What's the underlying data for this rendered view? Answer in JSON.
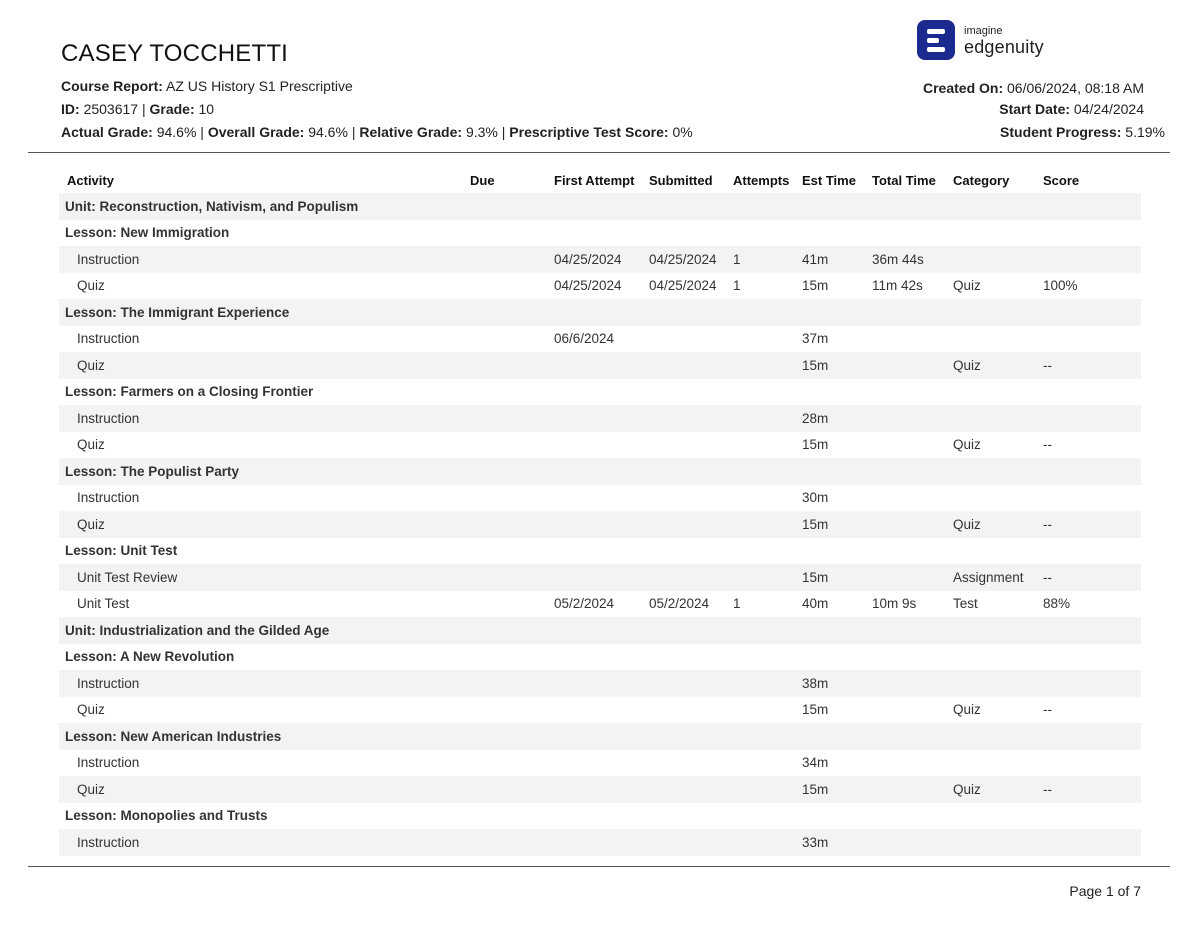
{
  "student": {
    "name": "CASEY TOCCHETTI"
  },
  "course": {
    "course_report_label": "Course Report:",
    "course_report_value": "AZ US History S1 Prescriptive",
    "id_label": "ID:",
    "id_value": "2503617",
    "sep": "|",
    "grade_label": "Grade:",
    "grade_value": "10",
    "actual_grade_label": "Actual Grade:",
    "actual_grade_value": "94.6%",
    "overall_grade_label": "Overall Grade:",
    "overall_grade_value": "94.6%",
    "relative_grade_label": "Relative Grade:",
    "relative_grade_value": "9.3%",
    "prescriptive_label": "Prescriptive Test Score:",
    "prescriptive_value": "0%",
    "created_label": "Created On:",
    "created_value": "06/06/2024, 08:18 AM",
    "start_label": "Start Date:",
    "start_value": "04/24/2024",
    "progress_label": "Student Progress:",
    "progress_value": "5.19%"
  },
  "logo": {
    "small": "imagine",
    "big": "edgenuity",
    "icon": "edgenuity-logo-icon",
    "color": "#1b2a8f"
  },
  "table": {
    "columns": [
      "Activity",
      "Due",
      "First Attempt",
      "Submitted",
      "Attempts",
      "Est Time",
      "Total Time",
      "Category",
      "Score"
    ],
    "rows": [
      {
        "type": "heading",
        "label": "Unit: Reconstruction, Nativism, and Populism"
      },
      {
        "type": "heading",
        "label": "Lesson: New Immigration"
      },
      {
        "type": "item",
        "cells": [
          "Instruction",
          "",
          "04/25/2024",
          "04/25/2024",
          "1",
          "41m",
          "36m 44s",
          "",
          ""
        ]
      },
      {
        "type": "item",
        "cells": [
          "Quiz",
          "",
          "04/25/2024",
          "04/25/2024",
          "1",
          "15m",
          "11m 42s",
          "Quiz",
          "100%"
        ]
      },
      {
        "type": "heading",
        "label": "Lesson: The Immigrant Experience"
      },
      {
        "type": "item",
        "cells": [
          "Instruction",
          "",
          "06/6/2024",
          "",
          "",
          "37m",
          "",
          "",
          ""
        ]
      },
      {
        "type": "item",
        "cells": [
          "Quiz",
          "",
          "",
          "",
          "",
          "15m",
          "",
          "Quiz",
          "--"
        ]
      },
      {
        "type": "heading",
        "label": "Lesson: Farmers on a Closing Frontier"
      },
      {
        "type": "item",
        "cells": [
          "Instruction",
          "",
          "",
          "",
          "",
          "28m",
          "",
          "",
          ""
        ]
      },
      {
        "type": "item",
        "cells": [
          "Quiz",
          "",
          "",
          "",
          "",
          "15m",
          "",
          "Quiz",
          "--"
        ]
      },
      {
        "type": "heading",
        "label": "Lesson: The Populist Party"
      },
      {
        "type": "item",
        "cells": [
          "Instruction",
          "",
          "",
          "",
          "",
          "30m",
          "",
          "",
          ""
        ]
      },
      {
        "type": "item",
        "cells": [
          "Quiz",
          "",
          "",
          "",
          "",
          "15m",
          "",
          "Quiz",
          "--"
        ]
      },
      {
        "type": "heading",
        "label": "Lesson: Unit Test"
      },
      {
        "type": "item",
        "cells": [
          "Unit Test Review",
          "",
          "",
          "",
          "",
          "15m",
          "",
          "Assignment",
          "--"
        ]
      },
      {
        "type": "item",
        "cells": [
          "Unit Test",
          "",
          "05/2/2024",
          "05/2/2024",
          "1",
          "40m",
          "10m 9s",
          "Test",
          "88%"
        ]
      },
      {
        "type": "heading",
        "label": "Unit: Industrialization and the Gilded Age"
      },
      {
        "type": "heading",
        "label": "Lesson: A New Revolution"
      },
      {
        "type": "item",
        "cells": [
          "Instruction",
          "",
          "",
          "",
          "",
          "38m",
          "",
          "",
          ""
        ]
      },
      {
        "type": "item",
        "cells": [
          "Quiz",
          "",
          "",
          "",
          "",
          "15m",
          "",
          "Quiz",
          "--"
        ]
      },
      {
        "type": "heading",
        "label": "Lesson: New American Industries"
      },
      {
        "type": "item",
        "cells": [
          "Instruction",
          "",
          "",
          "",
          "",
          "34m",
          "",
          "",
          ""
        ]
      },
      {
        "type": "item",
        "cells": [
          "Quiz",
          "",
          "",
          "",
          "",
          "15m",
          "",
          "Quiz",
          "--"
        ]
      },
      {
        "type": "heading",
        "label": "Lesson: Monopolies and Trusts"
      },
      {
        "type": "item",
        "cells": [
          "Instruction",
          "",
          "",
          "",
          "",
          "33m",
          "",
          "",
          ""
        ]
      }
    ]
  },
  "footer": {
    "page": "Page 1 of 7"
  }
}
